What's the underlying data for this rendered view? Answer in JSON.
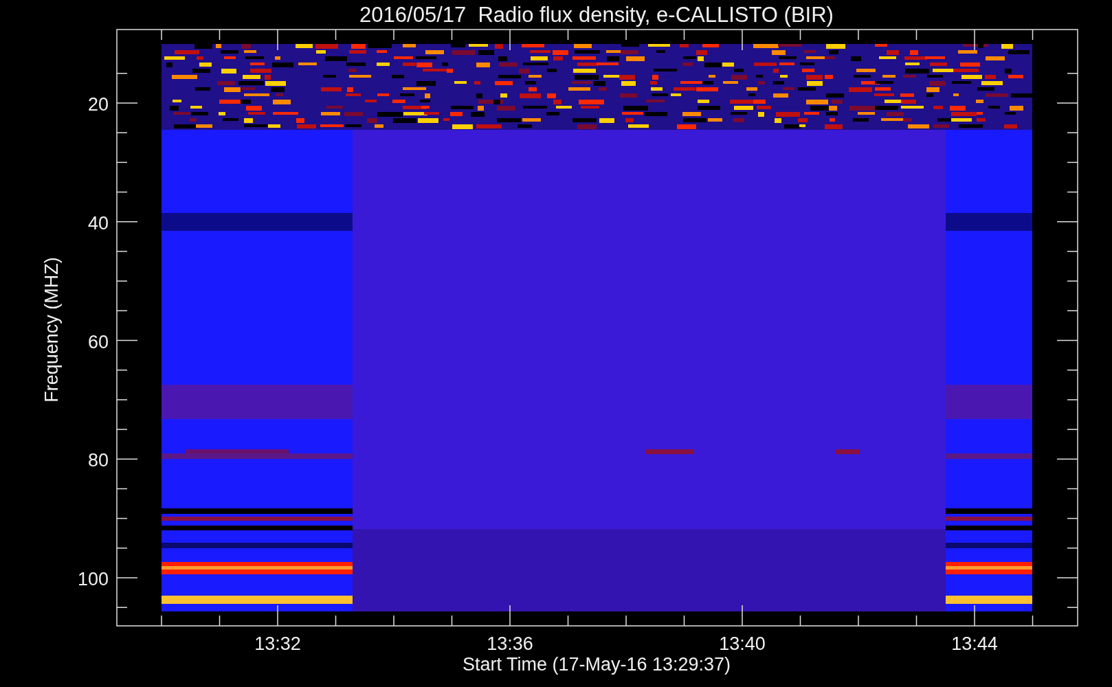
{
  "plot": {
    "title": "2016/05/17  Radio flux density, e-CALLISTO (BIR)",
    "ylabel": "Frequency (MHZ)",
    "xlabel": "Start Time (17-May-16 13:29:37)",
    "y_tick_labels": [
      "20",
      "40",
      "60",
      "80",
      "100"
    ],
    "x_tick_labels": [
      "13:32",
      "13:36",
      "13:40",
      "13:44"
    ]
  }
}
